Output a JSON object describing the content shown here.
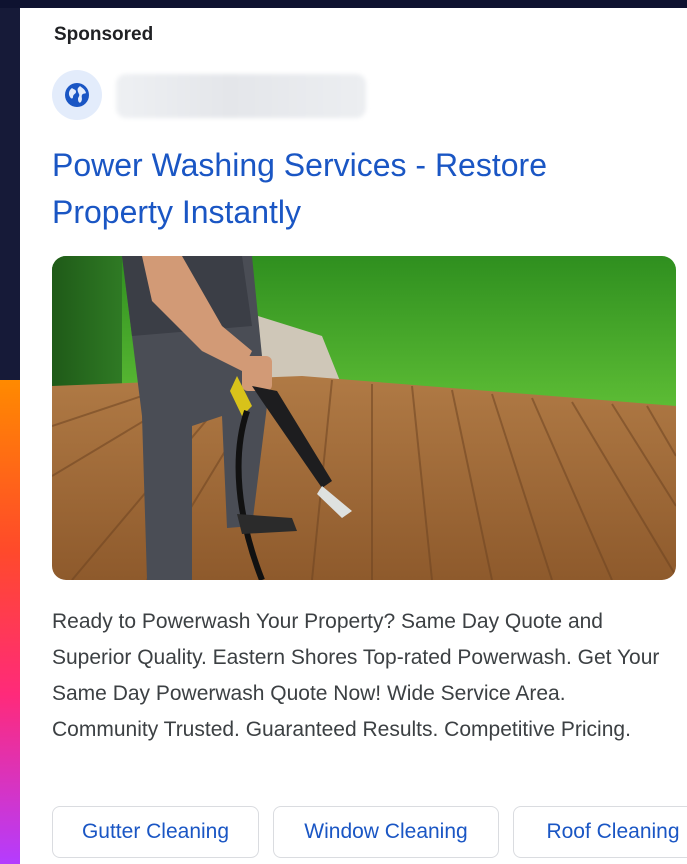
{
  "ad": {
    "sponsored_label": "Sponsored",
    "favicon_icon": "globe-icon",
    "headline_line1": "Power Washing Services - Restore",
    "headline_line2": "Property Instantly",
    "description": "Ready to Powerwash Your Property? Same Day Quote and Superior Quality. Eastern Shores Top-rated Powerwash. Get Your Same Day Powerwash Quote Now! Wide Service Area. Community Trusted. Guaranteed Results. Competitive Pricing.",
    "sitelinks": [
      {
        "label": "Gutter Cleaning"
      },
      {
        "label": "Window Cleaning"
      },
      {
        "label": "Roof Cleaning"
      }
    ]
  },
  "colors": {
    "link_blue": "#1a56c4",
    "text_gray": "#3c4043",
    "favicon_bg": "#e3ecfb",
    "favicon_fg": "#1a56c4"
  }
}
